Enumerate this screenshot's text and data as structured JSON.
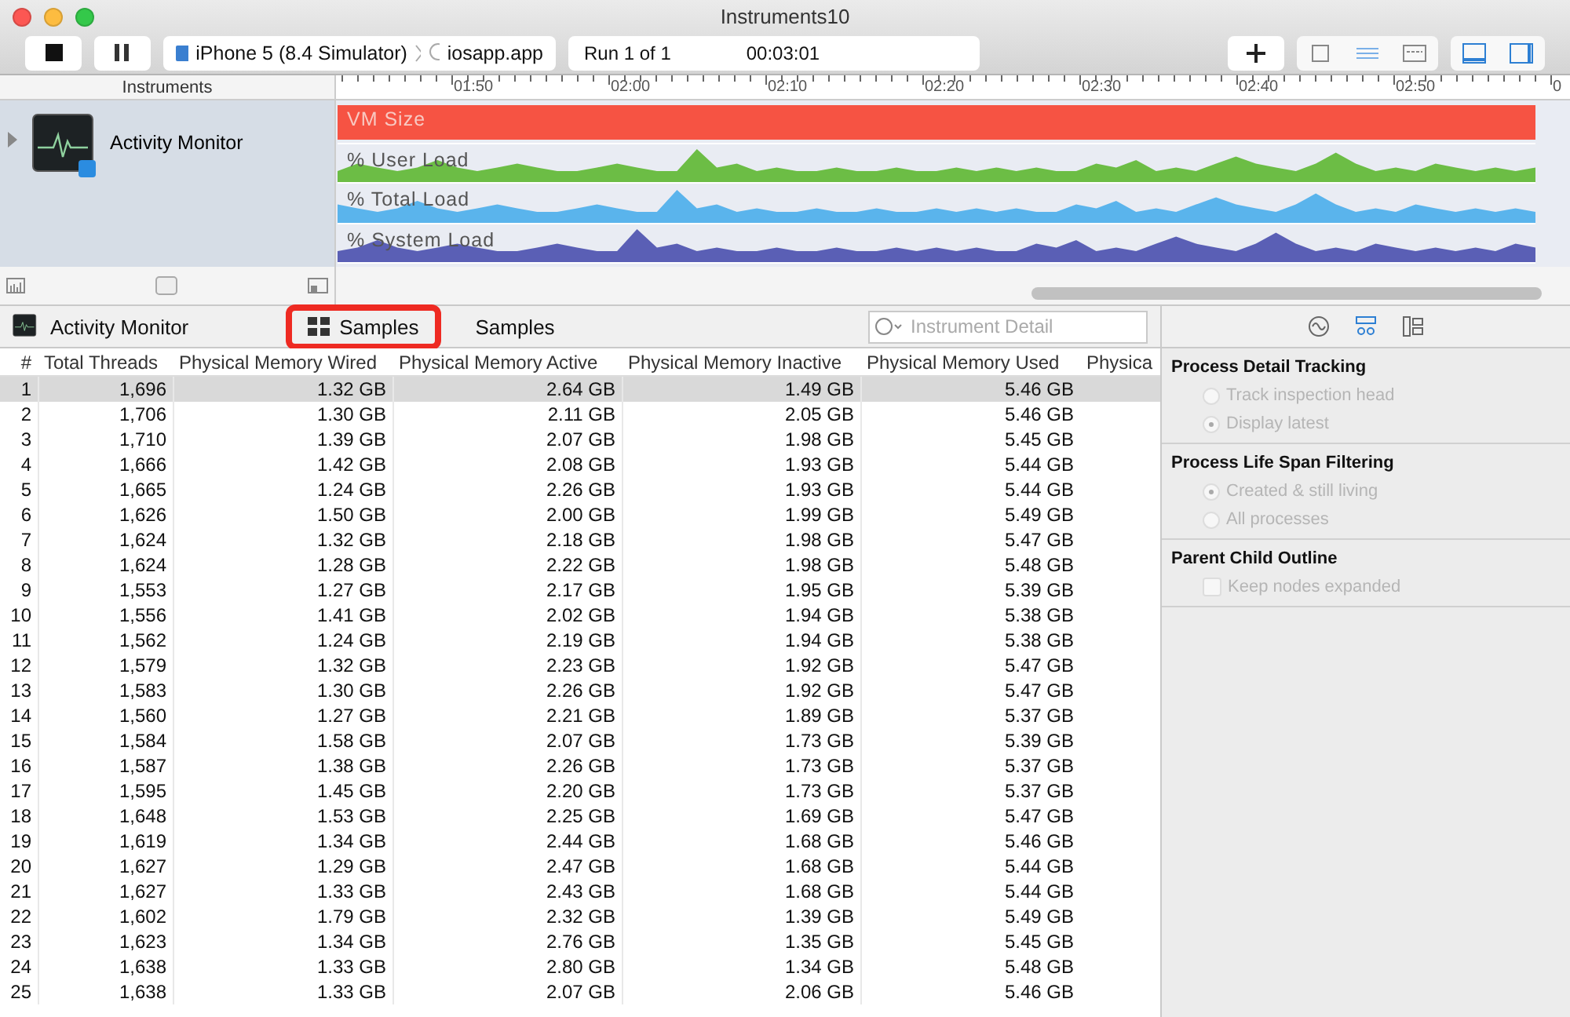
{
  "window": {
    "title": "Instruments10"
  },
  "toolbar": {
    "scheme": {
      "device": "iPhone 5 (8.4 Simulator)",
      "target": "iosapp.app"
    },
    "run": {
      "label": "Run 1 of 1",
      "time": "00:03:01"
    },
    "view_buttons": [
      {
        "selected": false
      },
      {
        "selected": true
      },
      {
        "selected": false
      }
    ],
    "layout_buttons": [
      {
        "selected": true
      },
      {
        "selected": true
      }
    ]
  },
  "timeline": {
    "header": "Instruments",
    "ticks": [
      "01:50",
      "02:00",
      "02:10",
      "02:20",
      "02:30",
      "02:40",
      "02:50",
      "0"
    ],
    "instrument": {
      "name": "Activity Monitor",
      "expanded": false
    },
    "tracks": [
      {
        "name": "VM Size",
        "kind": "bar",
        "color": "#f65343"
      },
      {
        "name": "% User Load",
        "kind": "wave",
        "color": "#6cbd45"
      },
      {
        "name": "% Total Load",
        "kind": "wave",
        "color": "#5ab4ec"
      },
      {
        "name": "% System Load",
        "kind": "wave",
        "color": "#5a5fb5"
      }
    ]
  },
  "path_bar": {
    "instrument": "Activity Monitor",
    "crumbs": [
      {
        "label": "Samples",
        "highlighted": true
      },
      {
        "label": "Samples",
        "highlighted": false
      }
    ],
    "search": {
      "placeholder": "Instrument Detail"
    }
  },
  "table": {
    "columns": [
      "#",
      "Total Threads",
      "Physical Memory Wired",
      "Physical Memory Active",
      "Physical Memory Inactive",
      "Physical Memory Used",
      "Physica"
    ],
    "rows": [
      {
        "selected": true,
        "cells": [
          "1",
          "1,696",
          "1.32 GB",
          "2.64 GB",
          "1.49 GB",
          "5.46 GB"
        ]
      },
      {
        "selected": false,
        "cells": [
          "2",
          "1,706",
          "1.30 GB",
          "2.11 GB",
          "2.05 GB",
          "5.46 GB"
        ]
      },
      {
        "selected": false,
        "cells": [
          "3",
          "1,710",
          "1.39 GB",
          "2.07 GB",
          "1.98 GB",
          "5.45 GB"
        ]
      },
      {
        "selected": false,
        "cells": [
          "4",
          "1,666",
          "1.42 GB",
          "2.08 GB",
          "1.93 GB",
          "5.44 GB"
        ]
      },
      {
        "selected": false,
        "cells": [
          "5",
          "1,665",
          "1.24 GB",
          "2.26 GB",
          "1.93 GB",
          "5.44 GB"
        ]
      },
      {
        "selected": false,
        "cells": [
          "6",
          "1,626",
          "1.50 GB",
          "2.00 GB",
          "1.99 GB",
          "5.49 GB"
        ]
      },
      {
        "selected": false,
        "cells": [
          "7",
          "1,624",
          "1.32 GB",
          "2.18 GB",
          "1.98 GB",
          "5.47 GB"
        ]
      },
      {
        "selected": false,
        "cells": [
          "8",
          "1,624",
          "1.28 GB",
          "2.22 GB",
          "1.98 GB",
          "5.48 GB"
        ]
      },
      {
        "selected": false,
        "cells": [
          "9",
          "1,553",
          "1.27 GB",
          "2.17 GB",
          "1.95 GB",
          "5.39 GB"
        ]
      },
      {
        "selected": false,
        "cells": [
          "10",
          "1,556",
          "1.41 GB",
          "2.02 GB",
          "1.94 GB",
          "5.38 GB"
        ]
      },
      {
        "selected": false,
        "cells": [
          "11",
          "1,562",
          "1.24 GB",
          "2.19 GB",
          "1.94 GB",
          "5.38 GB"
        ]
      },
      {
        "selected": false,
        "cells": [
          "12",
          "1,579",
          "1.32 GB",
          "2.23 GB",
          "1.92 GB",
          "5.47 GB"
        ]
      },
      {
        "selected": false,
        "cells": [
          "13",
          "1,583",
          "1.30 GB",
          "2.26 GB",
          "1.92 GB",
          "5.47 GB"
        ]
      },
      {
        "selected": false,
        "cells": [
          "14",
          "1,560",
          "1.27 GB",
          "2.21 GB",
          "1.89 GB",
          "5.37 GB"
        ]
      },
      {
        "selected": false,
        "cells": [
          "15",
          "1,584",
          "1.58 GB",
          "2.07 GB",
          "1.73 GB",
          "5.39 GB"
        ]
      },
      {
        "selected": false,
        "cells": [
          "16",
          "1,587",
          "1.38 GB",
          "2.26 GB",
          "1.73 GB",
          "5.37 GB"
        ]
      },
      {
        "selected": false,
        "cells": [
          "17",
          "1,595",
          "1.45 GB",
          "2.20 GB",
          "1.73 GB",
          "5.37 GB"
        ]
      },
      {
        "selected": false,
        "cells": [
          "18",
          "1,648",
          "1.53 GB",
          "2.25 GB",
          "1.69 GB",
          "5.47 GB"
        ]
      },
      {
        "selected": false,
        "cells": [
          "19",
          "1,619",
          "1.34 GB",
          "2.44 GB",
          "1.68 GB",
          "5.46 GB"
        ]
      },
      {
        "selected": false,
        "cells": [
          "20",
          "1,627",
          "1.29 GB",
          "2.47 GB",
          "1.68 GB",
          "5.44 GB"
        ]
      },
      {
        "selected": false,
        "cells": [
          "21",
          "1,627",
          "1.33 GB",
          "2.43 GB",
          "1.68 GB",
          "5.44 GB"
        ]
      },
      {
        "selected": false,
        "cells": [
          "22",
          "1,602",
          "1.79 GB",
          "2.32 GB",
          "1.39 GB",
          "5.49 GB"
        ]
      },
      {
        "selected": false,
        "cells": [
          "23",
          "1,623",
          "1.34 GB",
          "2.76 GB",
          "1.35 GB",
          "5.45 GB"
        ]
      },
      {
        "selected": false,
        "cells": [
          "24",
          "1,638",
          "1.33 GB",
          "2.80 GB",
          "1.34 GB",
          "5.48 GB"
        ]
      },
      {
        "selected": false,
        "cells": [
          "25",
          "1,638",
          "1.33 GB",
          "2.07 GB",
          "2.06 GB",
          "5.46 GB"
        ]
      }
    ]
  },
  "inspector": {
    "tabs": [
      {
        "selected": false
      },
      {
        "selected": true
      },
      {
        "selected": false
      }
    ],
    "sections": [
      {
        "title": "Process Detail Tracking",
        "options": [
          {
            "kind": "radio",
            "label": "Track inspection head",
            "selected": false,
            "disabled": true
          },
          {
            "kind": "radio",
            "label": "Display latest",
            "selected": true,
            "disabled": true
          }
        ]
      },
      {
        "title": "Process Life Span Filtering",
        "options": [
          {
            "kind": "radio",
            "label": "Created & still living",
            "selected": true,
            "disabled": true
          },
          {
            "kind": "radio",
            "label": "All processes",
            "selected": false,
            "disabled": true
          }
        ]
      },
      {
        "title": "Parent Child Outline",
        "options": [
          {
            "kind": "checkbox",
            "label": "Keep nodes expanded",
            "checked": false,
            "disabled": true
          }
        ]
      }
    ]
  }
}
